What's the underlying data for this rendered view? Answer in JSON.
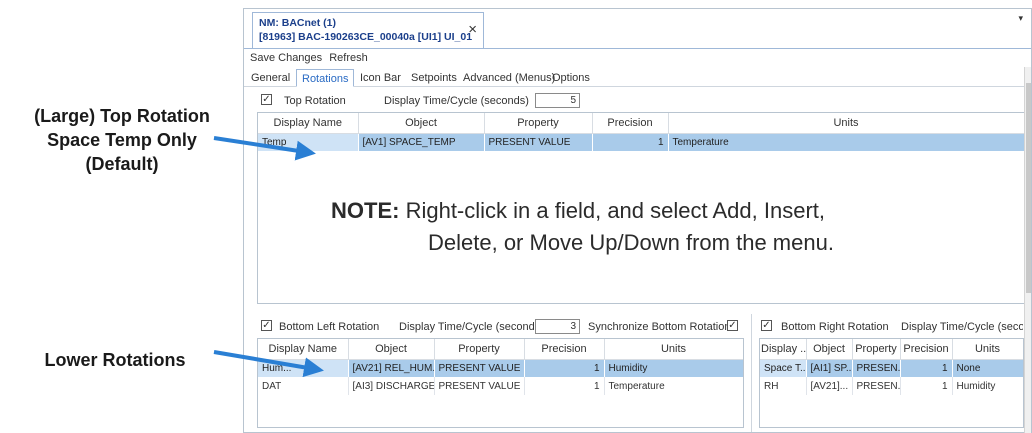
{
  "callouts": {
    "top": [
      "(Large) Top Rotation",
      "Space Temp Only",
      "(Default)"
    ],
    "bottom": "Lower Rotations"
  },
  "window": {
    "tab_title_1": "NM: BACnet (1)",
    "tab_title_2": "[81963] BAC-190263CE_00040a [UI1] UI_01",
    "close": "×",
    "menu_arrow": "▾",
    "toolbar": {
      "save": "Save Changes",
      "refresh": "Refresh"
    },
    "tabs": [
      "General",
      "Rotations",
      "Icon Bar",
      "Setpoints",
      "Advanced (Menus)",
      "Options"
    ],
    "active_tab": "Rotations"
  },
  "top_rotation": {
    "checkbox_label": "Top Rotation",
    "checked": "✓",
    "display_time_label": "Display Time/Cycle (seconds)",
    "display_time_value": "5",
    "columns": [
      "Display Name",
      "Object",
      "Property",
      "Precision",
      "Units"
    ],
    "rows": [
      {
        "name": "Temp",
        "object": "[AV1] SPACE_TEMP",
        "property": "PRESENT VALUE",
        "precision": "1",
        "units": "Temperature"
      }
    ]
  },
  "note": {
    "head": "NOTE:",
    "line1": "Right-click in a field, and select Add, Insert,",
    "line2": "Delete, or Move Up/Down from the menu."
  },
  "bottom_left": {
    "checkbox_label": "Bottom Left Rotation",
    "checked": "✓",
    "display_time_label": "Display Time/Cycle (seconds)",
    "display_time_value": "3",
    "sync_label": "Synchronize Bottom Rotations",
    "sync_checked": "✓",
    "columns": [
      "Display Name",
      "Object",
      "Property",
      "Precision",
      "Units"
    ],
    "rows": [
      {
        "name": "Hum...",
        "object": "[AV21] REL_HUM...",
        "property": "PRESENT VALUE",
        "precision": "1",
        "units": "Humidity"
      },
      {
        "name": "DAT",
        "object": "[AI3] DISCHARGE...",
        "property": "PRESENT VALUE",
        "precision": "1",
        "units": "Temperature"
      }
    ]
  },
  "bottom_right": {
    "checkbox_label": "Bottom Right Rotation",
    "checked": "✓",
    "display_time_label": "Display Time/Cycle (seconds)",
    "columns": [
      "Display ...",
      "Object",
      "Property",
      "Precision",
      "Units"
    ],
    "rows": [
      {
        "name": "Space T...",
        "object": "[AI1] SP...",
        "property": "PRESEN...",
        "precision": "1",
        "units": "None"
      },
      {
        "name": "RH",
        "object": "[AV21]...",
        "property": "PRESEN...",
        "precision": "1",
        "units": "Humidity"
      }
    ]
  },
  "colors": {
    "arrow": "#2a7fd4",
    "selection": "#a9cbea",
    "accent": "#2a6bc4"
  }
}
